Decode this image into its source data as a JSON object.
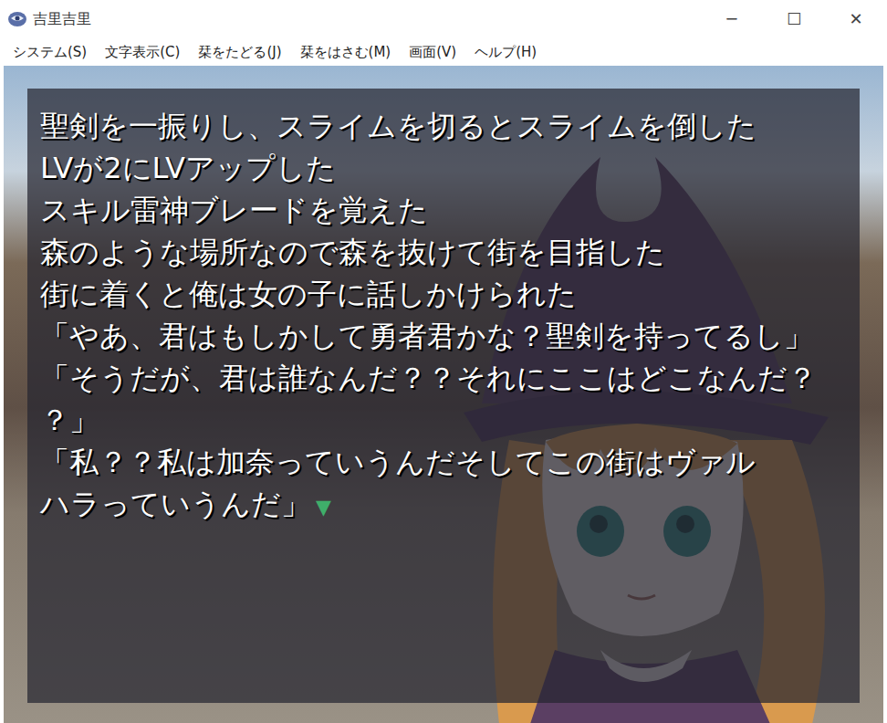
{
  "window": {
    "title": "吉里吉里",
    "controls": [
      "─",
      "☐",
      "✕"
    ]
  },
  "menu": [
    "システム(S)",
    "文字表示(C)",
    "栞をたどる(J)",
    "栞をはさむ(M)",
    "画面(V)",
    "ヘルプ(H)"
  ],
  "message": {
    "lines": [
      "聖剣を一振りし、スライムを切るとスライムを倒した",
      "LVが2にLVアップした",
      "スキル雷神ブレードを覚えた",
      "森のような場所なので森を抜けて街を目指した",
      "街に着くと俺は女の子に話しかけられた",
      "「やあ、君はもしかして勇者君かな？聖剣を持ってるし」",
      "「そうだが、君は誰なんだ？？それにここはどこなんだ？",
      "？」",
      "「私？？私は加奈っていうんだそしてこの街はヴァル",
      "ハラっていうんだ」"
    ],
    "cursor": "▼"
  }
}
